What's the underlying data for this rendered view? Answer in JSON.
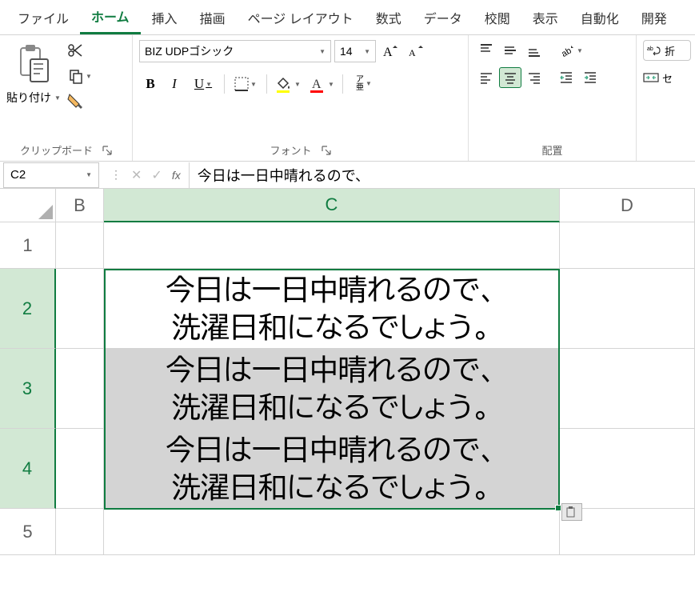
{
  "menu": {
    "file": "ファイル",
    "home": "ホーム",
    "insert": "挿入",
    "draw": "描画",
    "pagelayout": "ページ レイアウト",
    "formulas": "数式",
    "data": "データ",
    "review": "校閲",
    "view": "表示",
    "automate": "自動化",
    "developer": "開発"
  },
  "ribbon": {
    "clipboard_label": "クリップボード",
    "paste_label": "貼り付け",
    "font_label": "フォント",
    "font_name": "BIZ UDPゴシック",
    "font_size": "14",
    "align_label": "配置",
    "wrap_label": "折",
    "merge_label": "セ"
  },
  "formula": {
    "cell_ref": "C2",
    "value": "今日は一日中晴れるので、"
  },
  "grid": {
    "cols": [
      "B",
      "C",
      "D"
    ],
    "rows": [
      "1",
      "2",
      "3",
      "4",
      "5"
    ],
    "cells": {
      "C2": "今日は一日中晴れるので、\n洗濯日和になるでしょう。",
      "C3": "今日は一日中晴れるので、\n洗濯日和になるでしょう。",
      "C4": "今日は一日中晴れるので、\n洗濯日和になるでしょう。"
    },
    "selected_range": "C2:C4",
    "active_cell": "C2"
  },
  "style_buttons": {
    "bold": "B",
    "italic": "I",
    "underline": "U",
    "ruby": "ア\n亜"
  }
}
